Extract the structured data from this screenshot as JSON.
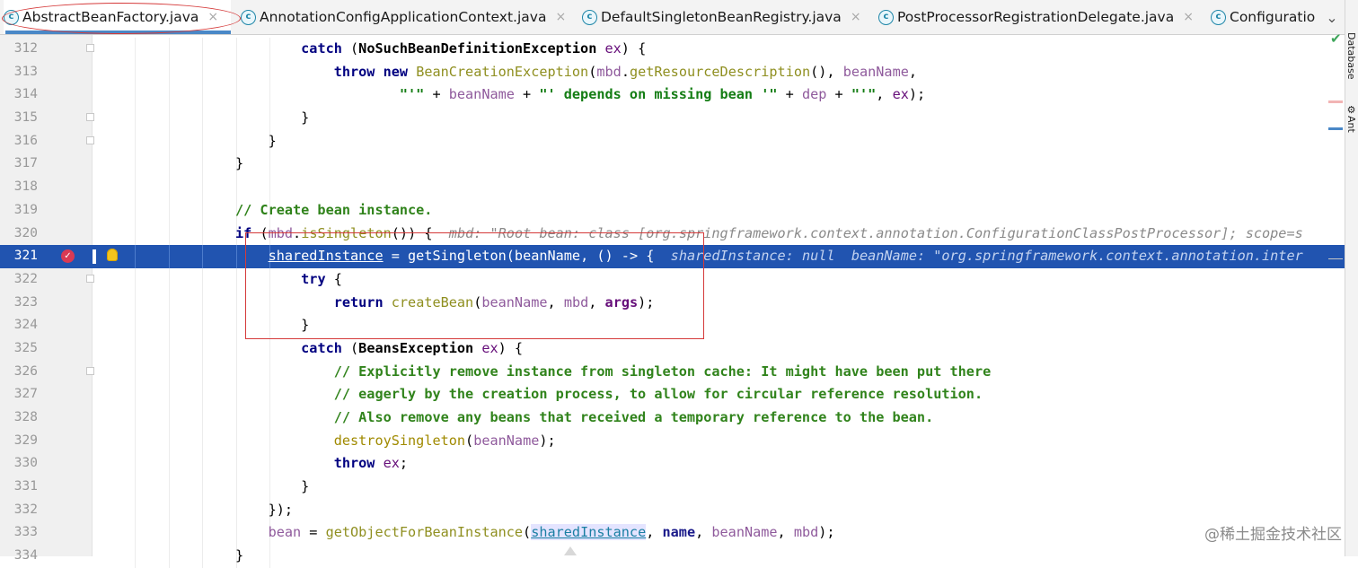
{
  "tabs": [
    {
      "label": "AbstractBeanFactory.java",
      "active": true,
      "closable": true
    },
    {
      "label": "AnnotationConfigApplicationContext.java",
      "active": false,
      "closable": true
    },
    {
      "label": "DefaultSingletonBeanRegistry.java",
      "active": false,
      "closable": true
    },
    {
      "label": "PostProcessorRegistrationDelegate.java",
      "active": false,
      "closable": true
    },
    {
      "label": "Configuratio",
      "active": false,
      "closable": false
    }
  ],
  "tab_icon_letter": "c",
  "close_glyph": "×",
  "tabs_more_glyph": "⌄",
  "right_tools": {
    "database": "Database",
    "ant": "Ant"
  },
  "lines": [
    {
      "n": "312",
      "html": "        <span class='kw'>catch</span> (<span class='ty'>NoSuchBeanDefinitionException</span> <span class='fld'>ex</span>) {"
    },
    {
      "n": "313",
      "html": "            <span class='kw'>throw new</span> <span class='fn'>BeanCreationException</span>(<span class='pv'>mbd</span>.<span class='fn'>getResourceDescription</span>(), <span class='pv'>beanName</span>,"
    },
    {
      "n": "314",
      "html": "                    <span class='st'>\"'\"</span> + <span class='pv'>beanName</span> + <span class='st'>\"' depends on missing bean '\"</span> + <span class='pv'>dep</span> + <span class='st'>\"'\"</span>, <span class='fld'>ex</span>);"
    },
    {
      "n": "315",
      "html": "        }"
    },
    {
      "n": "316",
      "html": "    }"
    },
    {
      "n": "317",
      "html": "}"
    },
    {
      "n": "318",
      "html": ""
    },
    {
      "n": "319",
      "html": "<span class='cm'>// Create bean instance.</span>"
    },
    {
      "n": "320",
      "html": "<span class='kw'>if</span> (<span class='pv'>mbd</span>.<span class='fn'>isSingleton</span>()) {  <span class='hint'>mbd: \"Root bean: class [org.springframework.context.annotation.ConfigurationClassPostProcessor]; scope=s</span>"
    },
    {
      "n": "321",
      "current": true,
      "html": "    <span class='fld'>sharedInstance</span> = <span class='fn'>getSingleton</span>(<span class='pv'>beanName</span>, () -> {  <span class='hint'>sharedInstance: null  beanName: \"org.springframework.context.annotation.inter</span>"
    },
    {
      "n": "322",
      "html": "        <span class='kw'>try</span> {"
    },
    {
      "n": "323",
      "html": "            <span class='kw'>return</span> <span class='fn'>createBean</span>(<span class='pv'>beanName</span>, <span class='pv'>mbd</span>, <span class='pvb'>args</span>);"
    },
    {
      "n": "324",
      "html": "        }"
    },
    {
      "n": "325",
      "html": "        <span class='kw'>catch</span> (<span class='ty'>BeansException</span> <span class='fld'>ex</span>) {"
    },
    {
      "n": "326",
      "html": "            <span class='cm'>// Explicitly remove instance from singleton cache: It might have been put there</span>"
    },
    {
      "n": "327",
      "html": "            <span class='cm'>// eagerly by the creation process, to allow for circular reference resolution.</span>"
    },
    {
      "n": "328",
      "html": "            <span class='cm'>// Also remove any beans that received a temporary reference to the bean.</span>"
    },
    {
      "n": "329",
      "html": "            <span class='fnr'>destroySingleton</span>(<span class='pv'>beanName</span>);"
    },
    {
      "n": "330",
      "html": "            <span class='kw'>throw</span> <span class='fld'>ex</span>;"
    },
    {
      "n": "331",
      "html": "        }"
    },
    {
      "n": "332",
      "html": "    });"
    },
    {
      "n": "333",
      "html": "    <span class='pv'>bean</span> = <span class='fn'>getObjectForBeanInstance</span>(<span class='lnk'>sharedInstance</span>, <span class='fld' style='font-weight:bold;color:#1a1a8a'>name</span>, <span class='pv'>beanName</span>, <span class='pv'>mbd</span>);"
    },
    {
      "n": "334",
      "html": "}"
    }
  ],
  "watermark": "@稀土掘金技术社区",
  "colors": {
    "current_line": "#2154b0",
    "breakpoint": "#d93a54",
    "annotation": "#d53a3a"
  }
}
